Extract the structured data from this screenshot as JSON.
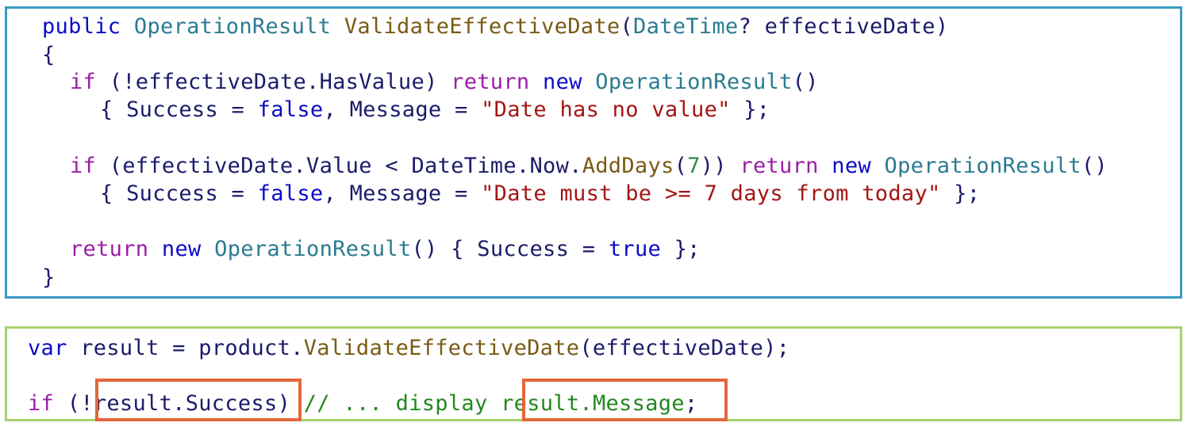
{
  "colors": {
    "method_border": "#3a9bc4",
    "usage_border": "#a7d16f",
    "highlight": "#e5663a",
    "keyword": "#0b0bc8",
    "control": "#9b1fa6",
    "type": "#2b7b91",
    "method": "#7a5a14",
    "string": "#a31515",
    "comment": "#22881e"
  },
  "method_code": {
    "l1": {
      "kw_public": "public",
      "type_result": "OperationResult",
      "method_name": "ValidateEffectiveDate",
      "paren_open": "(",
      "type_param": "DateTime",
      "param_rest": "? effectiveDate)"
    },
    "l2": {
      "brace": "{"
    },
    "l3": {
      "kw_if": "if",
      "cond": "(!effectiveDate.HasValue)",
      "kw_return": "return",
      "kw_new": "new",
      "type": "OperationResult",
      "tail": "()"
    },
    "l4": {
      "head": "{ Success = ",
      "kw_false": "false",
      "mid": ", Message = ",
      "str": "\"Date has no value\"",
      "tail": " };"
    },
    "l6": {
      "kw_if": "if",
      "cond_a": "(effectiveDate.Value < DateTime.Now.",
      "method": "AddDays",
      "paren_open": "(",
      "num": "7",
      "cond_b": "))",
      "kw_return": "return",
      "kw_new": "new",
      "type": "OperationResult",
      "tail": "()"
    },
    "l7": {
      "head": "{ Success = ",
      "kw_false": "false",
      "mid": ", Message = ",
      "str": "\"Date must be >= 7 days from today\"",
      "tail": " };"
    },
    "l9": {
      "kw_return": "return",
      "kw_new": "new",
      "type": "OperationResult",
      "mid": "() { Success = ",
      "kw_true": "true",
      "tail": " };"
    },
    "l10": {
      "brace": "}"
    }
  },
  "usage_code": {
    "l1": {
      "kw_var": "var",
      "mid": "result = product.",
      "method": "ValidateEffectiveDate",
      "tail": "(effectiveDate);"
    },
    "l2": {
      "kw_if": "if",
      "head": "(!",
      "success": "result.Success",
      "close": ")",
      "comment": "// ... display",
      "message": "result.Message",
      "semi": ";"
    }
  }
}
